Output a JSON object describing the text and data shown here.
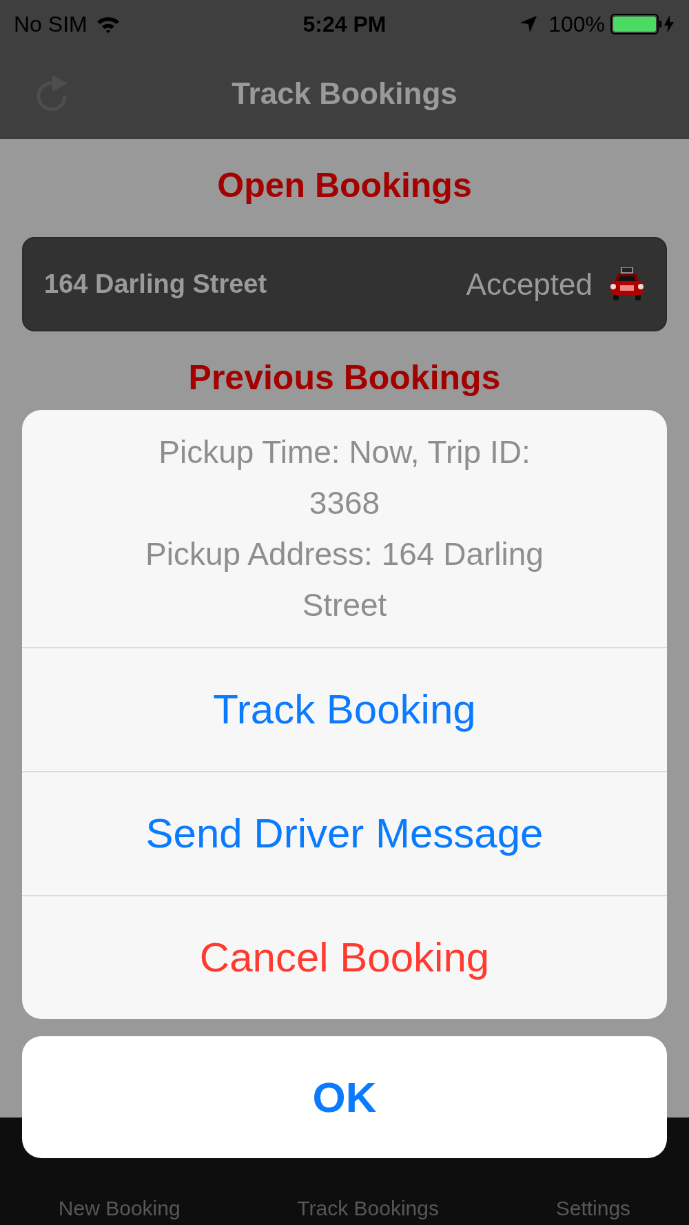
{
  "status_bar": {
    "carrier": "No SIM",
    "time": "5:24 PM",
    "battery": "100%"
  },
  "nav_bar": {
    "title": "Track Bookings"
  },
  "open_bookings": {
    "heading": "Open Bookings",
    "rows": [
      {
        "address": "164 Darling Street",
        "status": "Accepted"
      }
    ]
  },
  "previous_bookings": {
    "heading": "Previous Bookings"
  },
  "action_sheet": {
    "message": [
      "Pickup Time: Now, Trip ID:",
      "3368",
      "Pickup Address: 164 Darling",
      "Street"
    ],
    "actions": [
      {
        "label": "Track Booking",
        "kind": "default"
      },
      {
        "label": "Send Driver Message",
        "kind": "default"
      },
      {
        "label": "Cancel Booking",
        "kind": "destructive"
      }
    ],
    "cancel": "OK"
  },
  "tab_bar": [
    {
      "label": "New Booking"
    },
    {
      "label": "Track Bookings"
    },
    {
      "label": "Settings"
    }
  ]
}
